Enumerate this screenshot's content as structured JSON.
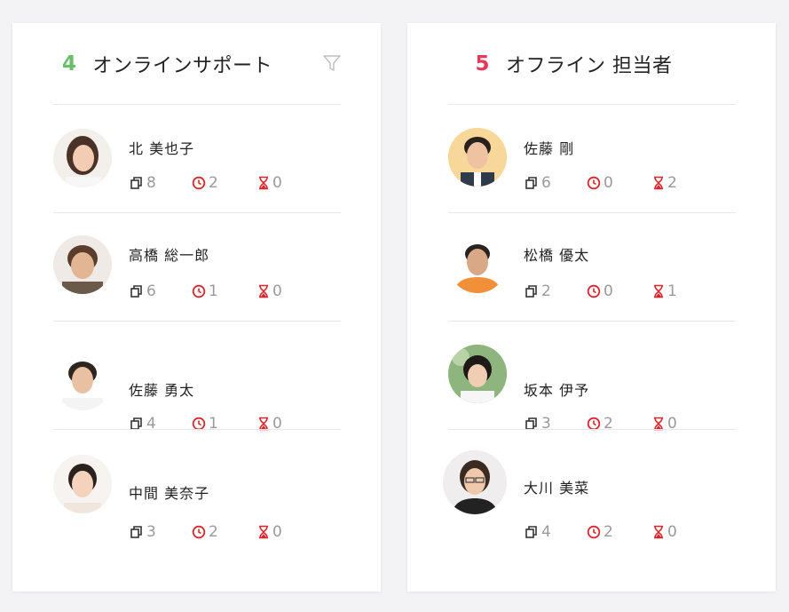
{
  "online": {
    "count": "4",
    "title": "オンラインサポート",
    "agents": [
      {
        "name": "北 美也子",
        "tickets": "8",
        "waiting": "2",
        "pending": "0"
      },
      {
        "name": "高橋 総一郎",
        "tickets": "6",
        "waiting": "1",
        "pending": "0"
      },
      {
        "name": "佐藤 勇太",
        "tickets": "4",
        "waiting": "1",
        "pending": "0"
      },
      {
        "name": "中間 美奈子",
        "tickets": "3",
        "waiting": "2",
        "pending": "0"
      }
    ]
  },
  "offline": {
    "count": "5",
    "title": "オフライン 担当者",
    "agents": [
      {
        "name": "佐藤 剛",
        "tickets": "6",
        "waiting": "0",
        "pending": "2"
      },
      {
        "name": "松橋 優太",
        "tickets": "2",
        "waiting": "0",
        "pending": "1"
      },
      {
        "name": "坂本 伊予",
        "tickets": "3",
        "waiting": "2",
        "pending": "0"
      },
      {
        "name": "大川 美菜",
        "tickets": "4",
        "waiting": "2",
        "pending": "0"
      }
    ]
  },
  "colors": {
    "online_accent": "#6bbd6a",
    "offline_accent": "#e5395a",
    "stat_icon_red": "#d9252b",
    "stat_text": "#9a9a9a"
  },
  "icons": {
    "filter": "filter-icon",
    "tickets": "tickets-icon",
    "waiting": "clock-icon",
    "pending": "hourglass-icon"
  }
}
